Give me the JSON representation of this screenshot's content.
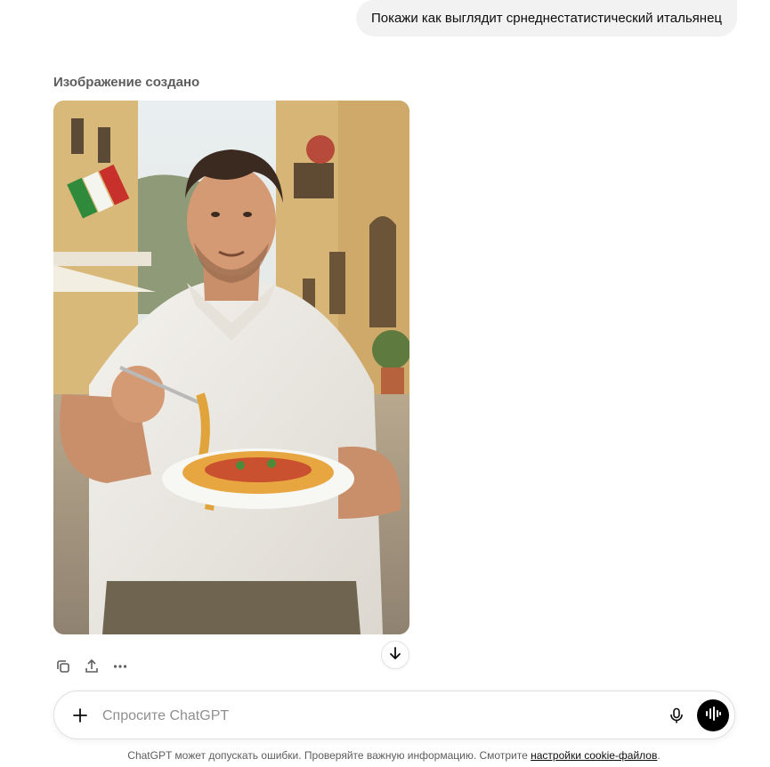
{
  "conversation": {
    "user_message": "Покажи как выглядит срнеднестатистический итальянец",
    "assistant": {
      "image_status": "Изображение создано"
    }
  },
  "actions": {
    "icons": [
      "copy-icon",
      "share-icon",
      "more-icon"
    ]
  },
  "scroll": {
    "icon": "arrow-down-icon"
  },
  "composer": {
    "placeholder": "Спросите ChatGPT",
    "value": "",
    "icons": [
      "plus-icon",
      "microphone-icon",
      "voice-mode-icon"
    ]
  },
  "footer": {
    "disclaimer": "ChatGPT может допускать ошибки. Проверяйте важную информацию. Смотрите",
    "link": "настройки cookie-файлов",
    "period": "."
  },
  "colors": {
    "bubble": "#f2f2f2",
    "muted_text": "#5d5d5d",
    "voice_button": "#000000"
  }
}
